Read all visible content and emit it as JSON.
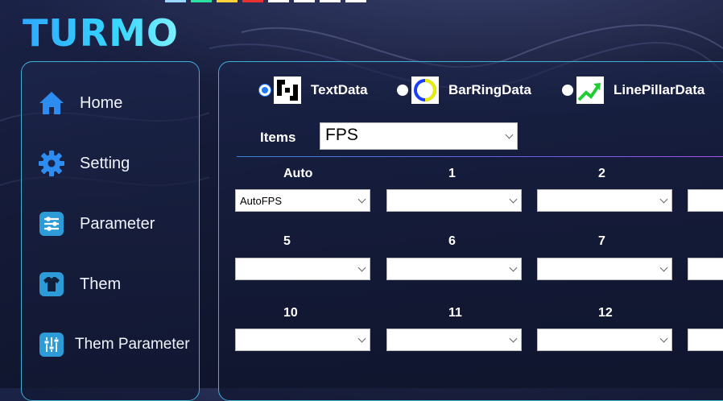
{
  "app": {
    "logo_text": "TURMO"
  },
  "sidebar": {
    "items": [
      {
        "label": "Home",
        "icon": "home-icon"
      },
      {
        "label": "Setting",
        "icon": "gear-icon"
      },
      {
        "label": "Parameter",
        "icon": "sliders-icon"
      },
      {
        "label": "Them",
        "icon": "shirt-icon"
      },
      {
        "label": "Them Parameter",
        "icon": "equalizer-icon"
      }
    ]
  },
  "data_types": {
    "selected": "TextData",
    "options": [
      {
        "label": "TextData",
        "icon": "text-data-icon"
      },
      {
        "label": "BarRingData",
        "icon": "bar-ring-icon"
      },
      {
        "label": "LinePillarData",
        "icon": "line-chart-icon"
      }
    ]
  },
  "items": {
    "label": "Items",
    "value": "FPS"
  },
  "grid": {
    "row1": {
      "labels": [
        "Auto",
        "1",
        "2",
        ""
      ],
      "values": [
        "AutoFPS",
        "",
        "",
        ""
      ]
    },
    "row2": {
      "labels": [
        "5",
        "6",
        "7",
        ""
      ],
      "values": [
        "",
        "",
        "",
        ""
      ]
    },
    "row3": {
      "labels": [
        "10",
        "11",
        "12",
        ""
      ],
      "values": [
        "",
        "",
        "",
        ""
      ]
    }
  },
  "colors": {
    "accent": "#37d6ff",
    "panel_border": "#3fb0d6",
    "radio_selected": "#1e78ff"
  }
}
